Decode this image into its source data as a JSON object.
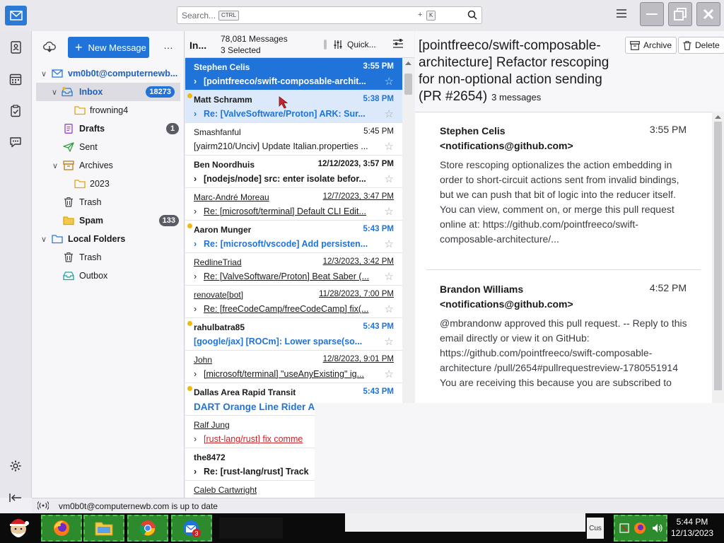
{
  "search": {
    "placeholder": "Search...",
    "key1": "CTRL",
    "plus": "+",
    "key2": "K"
  },
  "folder_pane": {
    "new_message": "New Message",
    "more": "…",
    "account": "vm0b0t@computernewb...",
    "folders": [
      {
        "label": "Inbox",
        "badge": "18273"
      },
      {
        "label": "frowning4"
      },
      {
        "label": "Drafts",
        "badge": "1"
      },
      {
        "label": "Sent"
      },
      {
        "label": "Archives"
      },
      {
        "label": "2023"
      },
      {
        "label": "Trash"
      },
      {
        "label": "Spam",
        "badge": "133"
      },
      {
        "label": "Local Folders"
      },
      {
        "label": "Trash"
      },
      {
        "label": "Outbox"
      }
    ]
  },
  "thread_pane": {
    "folder": "In...",
    "count": "78,081 Messages",
    "selected": "3 Selected",
    "quick_filter": "Quick...",
    "messages": [
      {
        "from": "Stephen Celis",
        "date": "3:55 PM",
        "subject": "[pointfreeco/swift-composable-archit..."
      },
      {
        "from": "Matt Schramm",
        "date": "5:38 PM",
        "subject": "Re: [ValveSoftware/Proton] ARK: Sur..."
      },
      {
        "from": "Smashfanful",
        "date": "5:45 PM",
        "subject": "[yairm210/Unciv] Update Italian.properties ..."
      },
      {
        "from": "Ben Noordhuis",
        "date": "12/12/2023, 3:57 PM",
        "subject": "[nodejs/node] src: enter isolate befor..."
      },
      {
        "from": "Marc-André Moreau",
        "date": "12/7/2023, 3:47 PM",
        "subject": "Re: [microsoft/terminal] Default CLI Edit..."
      },
      {
        "from": "Aaron Munger",
        "date": "5:43 PM",
        "subject": "Re: [microsoft/vscode] Add persisten..."
      },
      {
        "from": "RedlineTriad",
        "date": "12/3/2023, 3:42 PM",
        "subject": "Re: [ValveSoftware/Proton] Beat Saber (..."
      },
      {
        "from": "renovate[bot]",
        "date": "11/28/2023, 7:00 PM",
        "subject": "Re: [freeCodeCamp/freeCodeCamp] fix(..."
      },
      {
        "from": "rahulbatra85",
        "date": "5:43 PM",
        "subject": "[google/jax] [ROCm]: Lower sparse(so..."
      },
      {
        "from": "John",
        "date": "12/8/2023, 9:01 PM",
        "subject": "[microsoft/terminal] \"useAnyExisting\" ig..."
      },
      {
        "from": "Dallas Area Rapid Transit",
        "date": "5:43 PM",
        "subject": "DART Orange Line Rider Ale"
      },
      {
        "from": "Ralf Jung",
        "date": "",
        "subject": "[rust-lang/rust] fix comme"
      },
      {
        "from": "the8472",
        "date": "",
        "subject": "Re: [rust-lang/rust] Track"
      },
      {
        "from": "Caleb Cartwright",
        "date": "",
        "subject": ""
      }
    ]
  },
  "message_pane": {
    "subject": "[pointfreeco/swift-composable-architecture] Refactor rescoping for non-optional action sending (PR #2654)",
    "count": "3 messages",
    "archive": "Archive",
    "delete": "Delete",
    "cards": [
      {
        "sender": "Stephen Celis <notifications@github.com>",
        "time": "3:55 PM",
        "snippet": "Store rescoping optionalizes the action embedding in order to short-circuit actions sent from invalid bindings, but we can push that bit of logic into the reducer itself. You can view, comment on, or merge this pull request online at: https://github.com/pointfreeco/swift-composable-architecture/..."
      },
      {
        "sender": "Brandon Williams <notifications@github.com>",
        "time": "4:52 PM",
        "snippet": "@mbrandonw approved this pull request. -- Reply to this email directly or view it on GitHub: https://github.com/pointfreeco/swift-composable-architecture /pull/2654#pullrequestreview-1780551914 You are receiving this because you are subscribed to"
      }
    ]
  },
  "status": {
    "text": "vm0b0t@computernewb.com is up to date"
  },
  "taskbar": {
    "cus": "Cus",
    "time": "5:44 PM",
    "date": "12/13/2023",
    "mail_badge": "3"
  }
}
